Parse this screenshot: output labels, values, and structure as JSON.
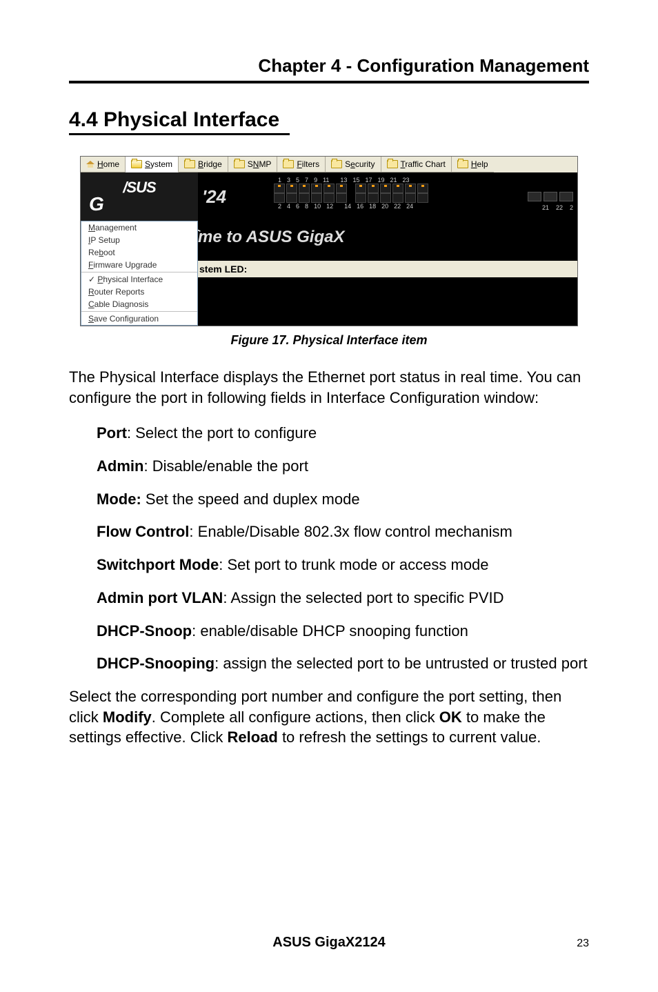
{
  "chapter_title": "Chapter 4 - Configuration Management",
  "section_title": "4.4 Physical Interface",
  "figure": {
    "menu": {
      "home": "Home",
      "system": "System",
      "bridge": "Bridge",
      "snmp": "SNMP",
      "filters": "Filters",
      "security": "Security",
      "traffic_chart": "Traffic Chart",
      "help": "Help"
    },
    "brand_asus": "/SUS",
    "brand_g": "G",
    "model_fragment": "'24",
    "system_dropdown": {
      "items": [
        "Management",
        "IP Setup",
        "Reboot",
        "Firmware Upgrade"
      ],
      "sep_after_index": 3,
      "items2": [
        "Physical Interface",
        "Router Reports",
        "Cable Diagnosis"
      ],
      "checked_index": 0,
      "sep_after2": 2,
      "items3": [
        "Save Configuration"
      ]
    },
    "port_numbers_top": [
      "1",
      "3",
      "5",
      "7",
      "9",
      "11",
      "13",
      "15",
      "17",
      "19",
      "21",
      "23"
    ],
    "port_numbers_bottom": [
      "2",
      "4",
      "6",
      "8",
      "10",
      "12",
      "14",
      "16",
      "18",
      "20",
      "22",
      "24"
    ],
    "sfp_numbers": [
      "21",
      "22",
      "2"
    ],
    "welcome_fragment": "me to ASUS GigaX",
    "led_label_fragment": "stem LED:"
  },
  "figure_caption": "Figure 17. Physical Interface item",
  "intro_paragraph": "The Physical Interface displays the Ethernet port status in real time. You can configure the port in following fields in Interface Configuration window:",
  "params": [
    {
      "key": "Port",
      "sep": ": ",
      "desc": "Select the port to configure"
    },
    {
      "key": "Admin",
      "sep": ": ",
      "desc": "Disable/enable the port"
    },
    {
      "key": "Mode:",
      "sep": " ",
      "desc": "Set the speed and duplex mode"
    },
    {
      "key": "Flow Control",
      "sep": ": ",
      "desc": "Enable/Disable 802.3x flow control mechanism"
    },
    {
      "key": "Switchport Mode",
      "sep": ": ",
      "desc": "Set port to trunk mode or access mode"
    },
    {
      "key": "Admin port VLAN",
      "sep": ": ",
      "desc": "Assign the selected port to specific PVID"
    },
    {
      "key": "DHCP-Snoop",
      "sep": ": ",
      "desc": "enable/disable DHCP snooping function"
    },
    {
      "key": "DHCP-Snooping",
      "sep": ": ",
      "desc": "assign the selected port to be untrusted or trusted port"
    }
  ],
  "outro": {
    "pre": "Select the corresponding port number and configure the port setting, then click ",
    "b1": "Modify",
    "mid1": ". Complete all configure actions, then click ",
    "b2": "OK",
    "mid2": " to make the settings effective. Click ",
    "b3": "Reload",
    "post": " to refresh the settings to current value."
  },
  "footer": {
    "product": "ASUS GigaX2124",
    "page": "23"
  }
}
